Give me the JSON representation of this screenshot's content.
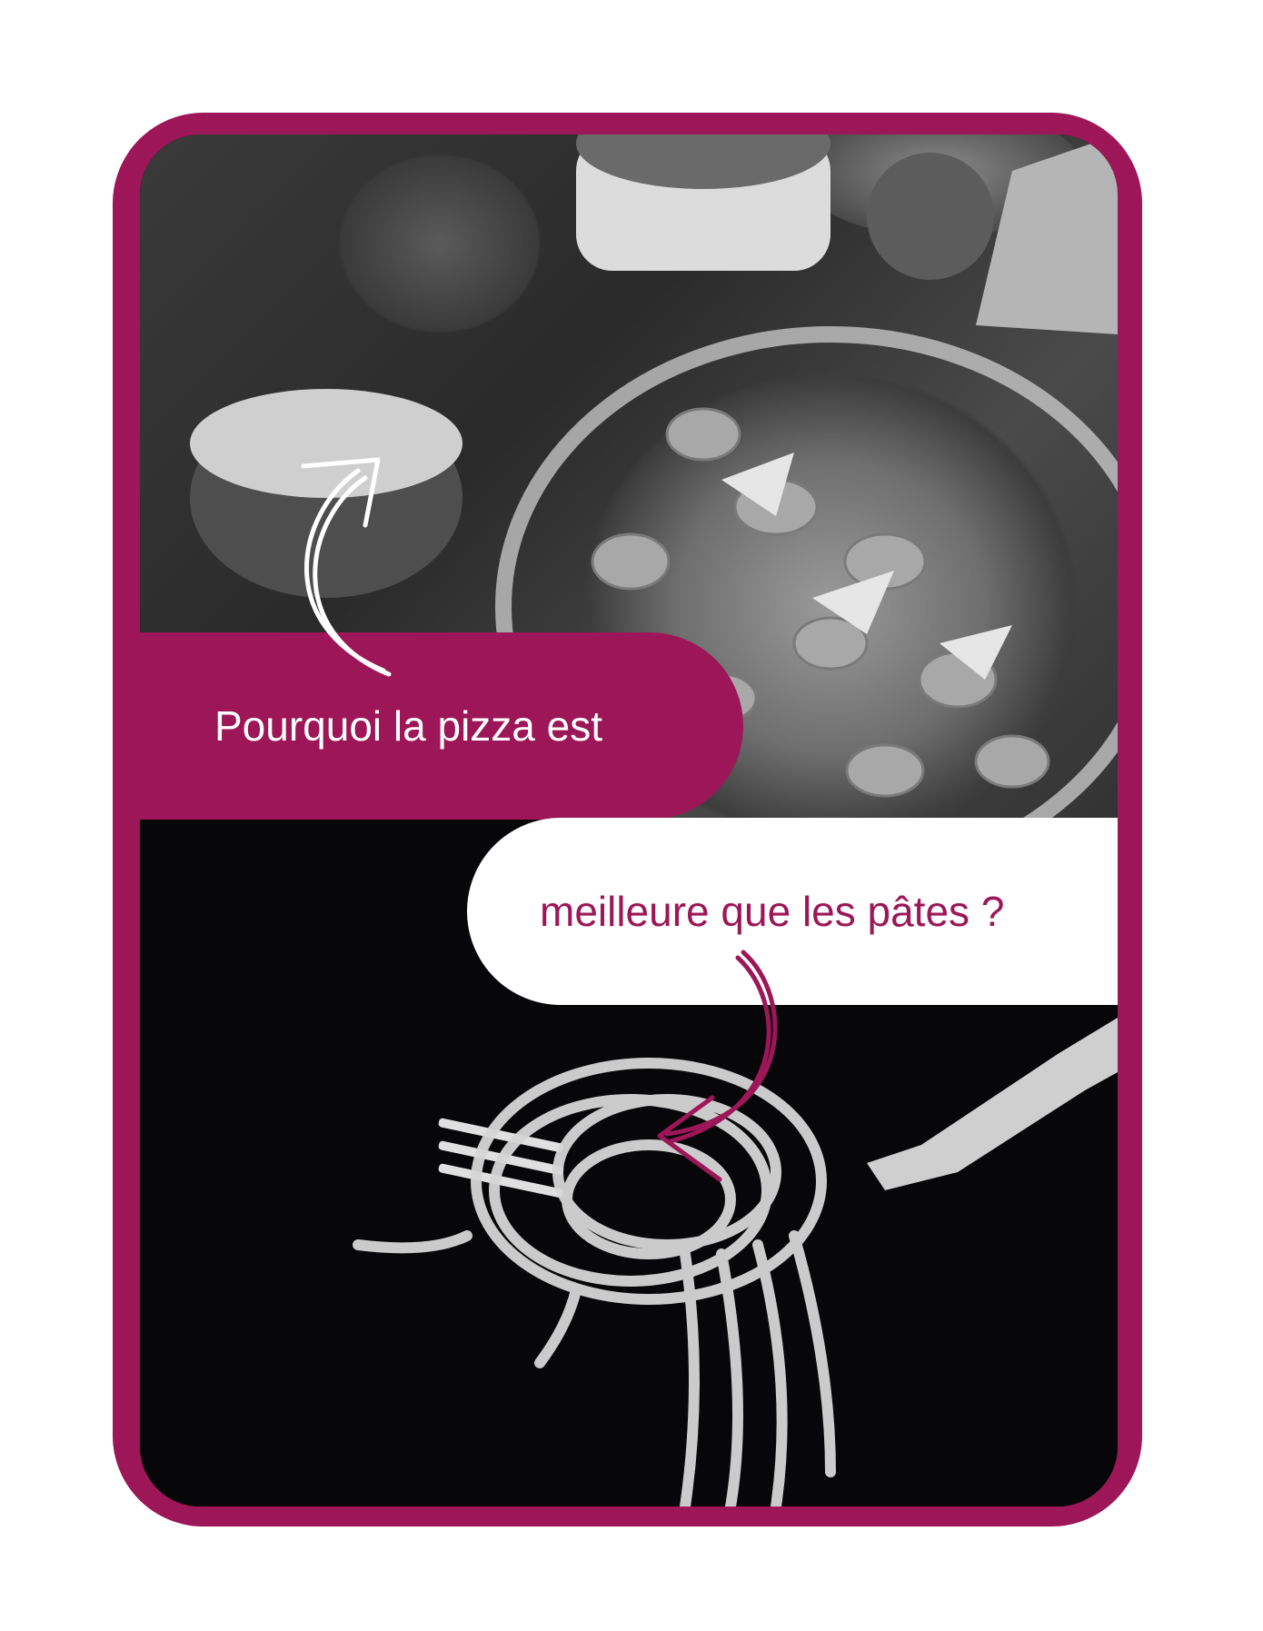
{
  "card": {
    "line1": "Pourquoi la pizza est",
    "line2": "meilleure que les pâtes ?"
  },
  "colors": {
    "accent": "#9c1658",
    "dark": "#070709",
    "light": "#ffffff"
  },
  "icons": {
    "top_arrow": "curved-arrow-up-icon",
    "bottom_arrow": "curved-arrow-down-icon"
  }
}
